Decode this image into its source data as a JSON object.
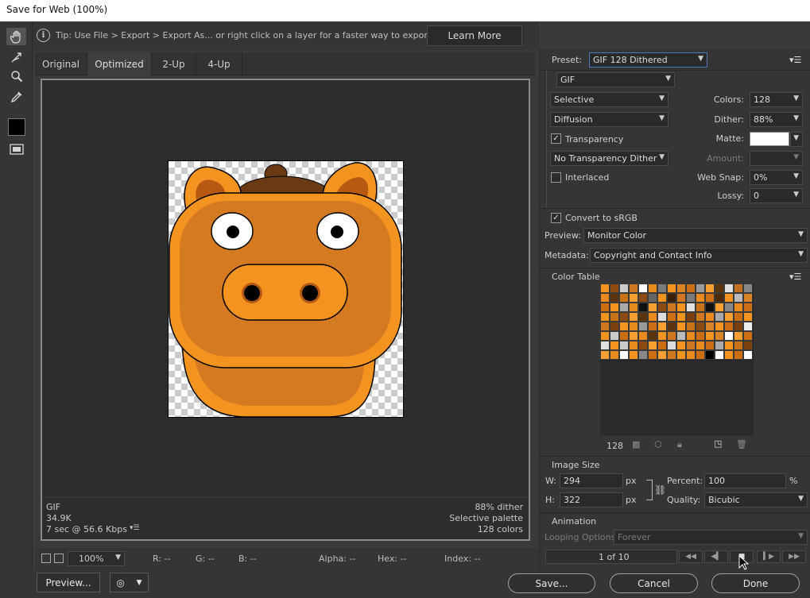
{
  "window": {
    "title": "Save for Web (100%)"
  },
  "tip": {
    "text": "Tip: Use File > Export > Export As...  or right click on a layer for a faster way to export assets",
    "learn_more": "Learn More"
  },
  "tabs": [
    "Original",
    "Optimized",
    "2-Up",
    "4-Up"
  ],
  "active_tab": "Optimized",
  "image_info": {
    "format": "GIF",
    "size": "34.9K",
    "speed": "7 sec @ 56.6 Kbps",
    "dither": "88% dither",
    "palette": "Selective palette",
    "colors": "128 colors"
  },
  "statusbar": {
    "zoom": "100%",
    "r": "R: --",
    "g": "G: --",
    "b": "B: --",
    "alpha": "Alpha: --",
    "hex": "Hex: --",
    "index": "Index: --"
  },
  "buttons": {
    "preview": "Preview...",
    "save": "Save...",
    "cancel": "Cancel",
    "done": "Done"
  },
  "settings": {
    "preset_label": "Preset:",
    "preset": "GIF 128 Dithered",
    "format": "GIF",
    "reduction": "Selective",
    "dither_algo": "Diffusion",
    "transparency_label": "Transparency",
    "transparency_checked": true,
    "transparency_dither": "No Transparency Dither",
    "interlaced_label": "Interlaced",
    "interlaced_checked": false,
    "colors_label": "Colors:",
    "colors": "128",
    "dither_label": "Dither:",
    "dither": "88%",
    "matte_label": "Matte:",
    "amount_label": "Amount:",
    "websnap_label": "Web Snap:",
    "websnap": "0%",
    "lossy_label": "Lossy:",
    "lossy": "0",
    "convert_srgb_label": "Convert to sRGB",
    "convert_srgb_checked": true,
    "preview_label": "Preview:",
    "preview_value": "Monitor Color",
    "metadata_label": "Metadata:",
    "metadata_value": "Copyright and Contact Info"
  },
  "color_table": {
    "title": "Color Table",
    "count": "128",
    "swatches": [
      "#f39320",
      "#8a4a12",
      "#cccccc",
      "#d07820",
      "#ffffff",
      "#e88a1c",
      "#7a7a7a",
      "#f39320",
      "#d88427",
      "#cc6e14",
      "#9a9a9a",
      "#f5a030",
      "#5a3510",
      "#e0e0e0",
      "#c07020",
      "#888888",
      "#e88a1c",
      "#5a3510",
      "#c87318",
      "#f5a030",
      "#8a4a12",
      "#666666",
      "#f39320",
      "#3a2008",
      "#d07820",
      "#7a7a7a",
      "#e88a1c",
      "#cc6e14",
      "#4a2a0c",
      "#f39320",
      "#bbbbbb",
      "#d88427",
      "#cc6e14",
      "#f39320",
      "#aaaaaa",
      "#e88a1c",
      "#101010",
      "#f5a030",
      "#8a4a12",
      "#d07820",
      "#f39320",
      "#e0e0e0",
      "#c87318",
      "#111111",
      "#f5a030",
      "#888888",
      "#e88a1c",
      "#cc6e14",
      "#f39320",
      "#c87318",
      "#8a4a12",
      "#f5a030",
      "#5a3510",
      "#e88a1c",
      "#dddddd",
      "#cc6e14",
      "#f39320",
      "#7a4010",
      "#d07820",
      "#e88a1c",
      "#aaaaaa",
      "#f5a030",
      "#cc6e14",
      "#f39320",
      "#d07820",
      "#7a4010",
      "#f39320",
      "#e88a1c",
      "#999999",
      "#cc6e14",
      "#f5a030",
      "#5a3510",
      "#f39320",
      "#c87318",
      "#8a4a12",
      "#d88427",
      "#f39320",
      "#cc6e14",
      "#7a4010",
      "#eeeeee",
      "#f39320",
      "#cccccc",
      "#cc6e14",
      "#f5a030",
      "#e88a1c",
      "#5a3510",
      "#f39320",
      "#d07820",
      "#bbbbbb",
      "#e88a1c",
      "#cc6e14",
      "#f39320",
      "#d88427",
      "#ffffff",
      "#f5a030",
      "#cc6e14",
      "#e0e0e0",
      "#f39320",
      "#cccccc",
      "#e88a1c",
      "#8a4a12",
      "#f5a030",
      "#cc6e14",
      "#dddddd",
      "#f39320",
      "#d07820",
      "#e88a1c",
      "#cc6e14",
      "#aaaaaa",
      "#f39320",
      "#c87318",
      "#7a4010",
      "#f5a030",
      "#e88a1c",
      "#ffffff",
      "#f39320",
      "#888888",
      "#cc6e14",
      "#f5a030",
      "#d07820",
      "#f39320",
      "#e88a1c",
      "#cc6e14",
      "#000000",
      "#ffffff",
      "#f39320",
      "#cc6e14",
      "#ffffff"
    ]
  },
  "image_size": {
    "title": "Image Size",
    "w_label": "W:",
    "w": "294",
    "h_label": "H:",
    "h": "322",
    "unit": "px",
    "percent_label": "Percent:",
    "percent": "100",
    "percent_unit": "%",
    "quality_label": "Quality:",
    "quality": "Bicubic"
  },
  "animation": {
    "title": "Animation",
    "looping_label": "Looping Options:",
    "looping": "Forever",
    "frame": "1 of 10"
  }
}
